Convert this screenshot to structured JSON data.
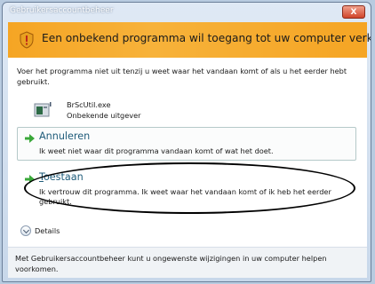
{
  "window": {
    "title": "Gebruikersaccountbeheer",
    "close_label": "X"
  },
  "banner": {
    "text": "Een onbekend programma wil toegang tot uw computer verkrijgen",
    "background": "#f5a524"
  },
  "intro": "Voer het programma niet uit tenzij u weet waar het vandaan komt of als u het eerder hebt gebruikt.",
  "program": {
    "name": "BrScUtil.exe",
    "publisher": "Onbekende uitgever"
  },
  "options": {
    "cancel": {
      "title": "Annuleren",
      "description": "Ik weet niet waar dit programma vandaan komt of wat het doet."
    },
    "allow": {
      "title_first": "T",
      "title_rest": "oestaan",
      "description": "Ik vertrouw dit programma. Ik weet waar het vandaan komt of ik heb het eerder gebruikt."
    }
  },
  "details": {
    "label": "Details"
  },
  "footer": {
    "text": "Met Gebruikersaccountbeheer kunt u ongewenste wijzigingen in uw computer helpen voorkomen."
  },
  "colors": {
    "accent": "#1f5c7a",
    "arrow": "#3aa83a"
  }
}
